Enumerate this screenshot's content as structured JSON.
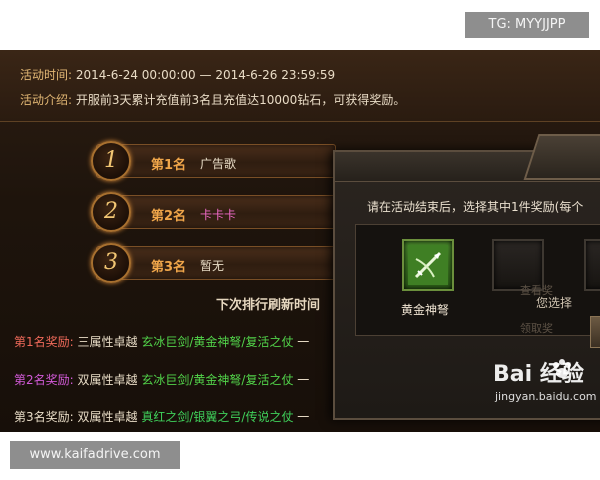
{
  "badges": {
    "tg": "TG: MYYJJPP",
    "site": "www.kaifadrive.com"
  },
  "activity": {
    "time_label": "活动时间:",
    "time_value": "2014-6-24 00:00:00 — 2014-6-26 23:59:59",
    "desc_label": "活动介绍:",
    "desc_value": "开服前3天累计充值前3名且充值达10000钻石，可获得奖励。"
  },
  "ranking": [
    {
      "num": "1",
      "title": "第1名",
      "name": "广告歌"
    },
    {
      "num": "2",
      "title": "第2名",
      "name": "卡卡卡"
    },
    {
      "num": "3",
      "title": "第3名",
      "name": "暂无"
    }
  ],
  "refresh_text": "下次排行刷新时间",
  "rewards": [
    {
      "label": "第1名奖励:",
      "tier": "三属性卓越",
      "items": "玄冰巨剑/黄金神弩/复活之仗",
      "tail": "一"
    },
    {
      "label": "第2名奖励:",
      "tier": "双属性卓越",
      "items": "玄冰巨剑/黄金神弩/复活之仗",
      "tail": "一"
    },
    {
      "label": "第3名奖励:",
      "tier": "双属性卓越",
      "items": "真红之剑/银翼之弓/传说之仗",
      "tail": "一"
    }
  ],
  "popup": {
    "instruction": "请在活动结束后，选择其中1件奖励(每个",
    "item_name": "黄金神弩",
    "side_text": "您选择",
    "faint_top": "查看奖",
    "faint_mid": "领取奖"
  },
  "watermark": {
    "logo": "Bai  经验",
    "url": "jingyan.baidu.com"
  },
  "colors": {
    "accent_gold": "#f0a64a",
    "reward_green": "#52d34a",
    "rank1_label": "#f06a5a",
    "rank2_label": "#d25ad8"
  },
  "icons": [
    "crossbow-icon",
    "paw-icon"
  ]
}
